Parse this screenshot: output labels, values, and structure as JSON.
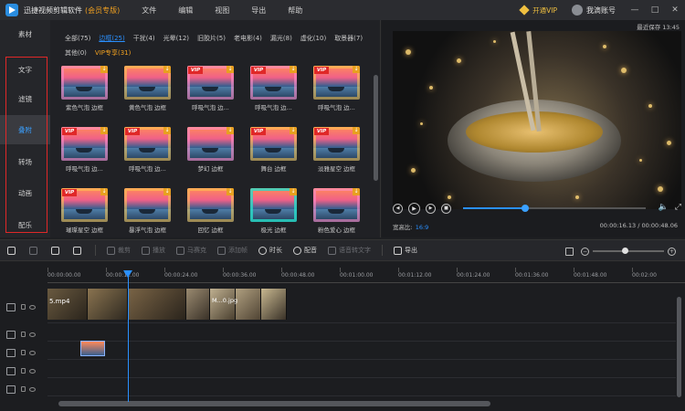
{
  "titlebar": {
    "app_name": "迅捷视频剪辑软件",
    "edition": "(会员专版)",
    "menu": [
      "文件",
      "编辑",
      "视图",
      "导出",
      "帮助"
    ],
    "vip_button": "开通VIP",
    "account": "我滴账号",
    "controls": [
      "—",
      "□",
      "✕"
    ]
  },
  "leftnav": {
    "top_item": "素材",
    "items": [
      "文字",
      "滤镜",
      "叠附",
      "转场",
      "动画",
      "配乐"
    ],
    "active": "叠附"
  },
  "assets": {
    "filters": [
      {
        "label": "全部(75)",
        "state": "normal"
      },
      {
        "label": "边框(25)",
        "state": "active"
      },
      {
        "label": "干扰(4)",
        "state": "normal"
      },
      {
        "label": "光晕(12)",
        "state": "normal"
      },
      {
        "label": "旧胶片(5)",
        "state": "normal"
      },
      {
        "label": "老电影(4)",
        "state": "normal"
      },
      {
        "label": "漏光(8)",
        "state": "normal"
      },
      {
        "label": "虚化(10)",
        "state": "normal"
      },
      {
        "label": "取景器(7)",
        "state": "normal"
      },
      {
        "label": "其他(0)",
        "state": "normal"
      },
      {
        "label": "VIP专享(31)",
        "state": "vip"
      }
    ],
    "tiles": [
      {
        "label": "紫色气泡 边框",
        "vip": false,
        "fx": "pink"
      },
      {
        "label": "黄色气泡 边框",
        "vip": false,
        "fx": "gold"
      },
      {
        "label": "呼吸气泡 边...",
        "vip": true,
        "fx": "pink"
      },
      {
        "label": "呼吸气泡 边...",
        "vip": true,
        "fx": "pink"
      },
      {
        "label": "呼吸气泡 边...",
        "vip": true,
        "fx": "gold"
      },
      {
        "label": "呼吸气泡 边...",
        "vip": true,
        "fx": "pink"
      },
      {
        "label": "呼吸气泡 边...",
        "vip": true,
        "fx": "gold"
      },
      {
        "label": "梦幻 边框",
        "vip": false,
        "fx": "pink"
      },
      {
        "label": "舞台 边框",
        "vip": true,
        "fx": "gold"
      },
      {
        "label": "淡雅星空 边框",
        "vip": true,
        "fx": "gold"
      },
      {
        "label": "璀璨星空 边框",
        "vip": true,
        "fx": "gold"
      },
      {
        "label": "暴浮气泡 边框",
        "vip": false,
        "fx": "gold"
      },
      {
        "label": "回忆 边框",
        "vip": false,
        "fx": "gold"
      },
      {
        "label": "极光 边框",
        "vip": false,
        "fx": "teal"
      },
      {
        "label": "粉色爱心 边框",
        "vip": false,
        "fx": "pink"
      }
    ]
  },
  "preview": {
    "save_note": "最近保存 13:45",
    "ratio_label": "宽高比:",
    "ratio_value": "16:9",
    "timecode": "00:00:16.13 / 00:00:48.06",
    "progress": 0.34,
    "icons": [
      "prev-frame-icon",
      "play-icon",
      "next-frame-icon",
      "stop-icon",
      "volume-icon",
      "fullscreen-icon"
    ]
  },
  "toolbar": {
    "items": [
      {
        "label": "",
        "name": "undo",
        "on": true
      },
      {
        "label": "",
        "name": "redo",
        "on": false
      },
      {
        "label": "",
        "name": "edit",
        "on": true
      },
      {
        "label": "",
        "name": "delete",
        "on": true
      },
      {
        "label": "裁剪",
        "name": "crop",
        "on": false
      },
      {
        "label": "播放",
        "name": "play",
        "on": false
      },
      {
        "label": "马赛克",
        "name": "mosaic",
        "on": false
      },
      {
        "label": "添加帧",
        "name": "add-frame",
        "on": false
      },
      {
        "label": "时长",
        "name": "duration",
        "on": true
      },
      {
        "label": "配音",
        "name": "dubbing",
        "on": true
      },
      {
        "label": "语音转文字",
        "name": "speech-to-text",
        "on": false
      },
      {
        "label": "导出",
        "name": "export",
        "on": true
      }
    ],
    "zoom_minus": "−",
    "zoom_plus": "+"
  },
  "timeline": {
    "ruler": [
      "00:00:00.00",
      "00:00:12.00",
      "00:00:24.00",
      "00:00:36.00",
      "00:00:48.00",
      "00:01:00.00",
      "00:01:12.00",
      "00:01:24.00",
      "00:01:36.00",
      "00:01:48.00",
      "00:02:00"
    ],
    "clip1": "5.mp4",
    "clip2": "M...0.jpg",
    "accent": "#2a90ff"
  },
  "colors": {
    "accent": "#2a90ff",
    "vip": "#f0a020",
    "highlight_box": "#e02828"
  }
}
